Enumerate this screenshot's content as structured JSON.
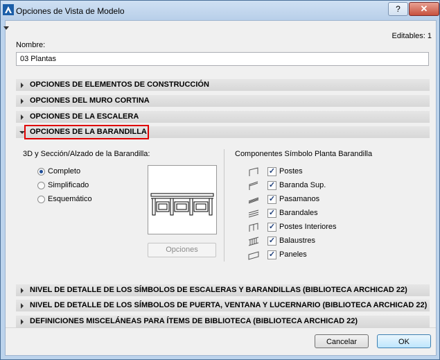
{
  "window": {
    "title": "Opciones de Vista de Modelo",
    "help_label": "?",
    "close_label": "✕"
  },
  "editables": "Editables: 1",
  "name": {
    "label": "Nombre:",
    "value": "03 Plantas"
  },
  "sections": {
    "construccion": "OPCIONES DE ELEMENTOS DE CONSTRUCCIÓN",
    "muro_cortina": "OPCIONES DEL MURO CORTINA",
    "escalera": "OPCIONES DE LA ESCALERA",
    "barandilla": "OPCIONES DE LA BARANDILLA",
    "nivel_escaleras": "NIVEL DE DETALLE DE LOS SÍMBOLOS DE ESCALERAS Y BARANDILLAS (BIBLIOTECA ARCHICAD 22)",
    "nivel_puerta": "NIVEL DE DETALLE DE LOS SÍMBOLOS DE PUERTA, VENTANA Y LUCERNARIO (BIBLIOTECA ARCHICAD 22)",
    "miscelaneas": "DEFINICIONES MISCELÁNEAS PARA ÍTEMS DE BIBLIOTECA (BIBLIOTECA ARCHICAD 22)"
  },
  "barandilla": {
    "left_title": "3D y Sección/Alzado de la Barandilla:",
    "radios": [
      {
        "label": "Completo",
        "selected": true
      },
      {
        "label": "Simplificado",
        "selected": false
      },
      {
        "label": "Esquemático",
        "selected": false
      }
    ],
    "options_button": "Opciones",
    "right_title": "Componentes Símbolo Planta Barandilla",
    "components": [
      {
        "label": "Postes",
        "checked": true,
        "icon": "post-symbol-icon"
      },
      {
        "label": "Baranda Sup.",
        "checked": true,
        "icon": "top-rail-symbol-icon"
      },
      {
        "label": "Pasamanos",
        "checked": true,
        "icon": "handrail-symbol-icon"
      },
      {
        "label": "Barandales",
        "checked": true,
        "icon": "rail-symbol-icon"
      },
      {
        "label": "Postes Interiores",
        "checked": true,
        "icon": "inner-post-symbol-icon"
      },
      {
        "label": "Balaustres",
        "checked": true,
        "icon": "baluster-symbol-icon"
      },
      {
        "label": "Paneles",
        "checked": true,
        "icon": "panel-symbol-icon"
      }
    ]
  },
  "buttons": {
    "cancel": "Cancelar",
    "ok": "OK"
  },
  "check_mark": "✓"
}
